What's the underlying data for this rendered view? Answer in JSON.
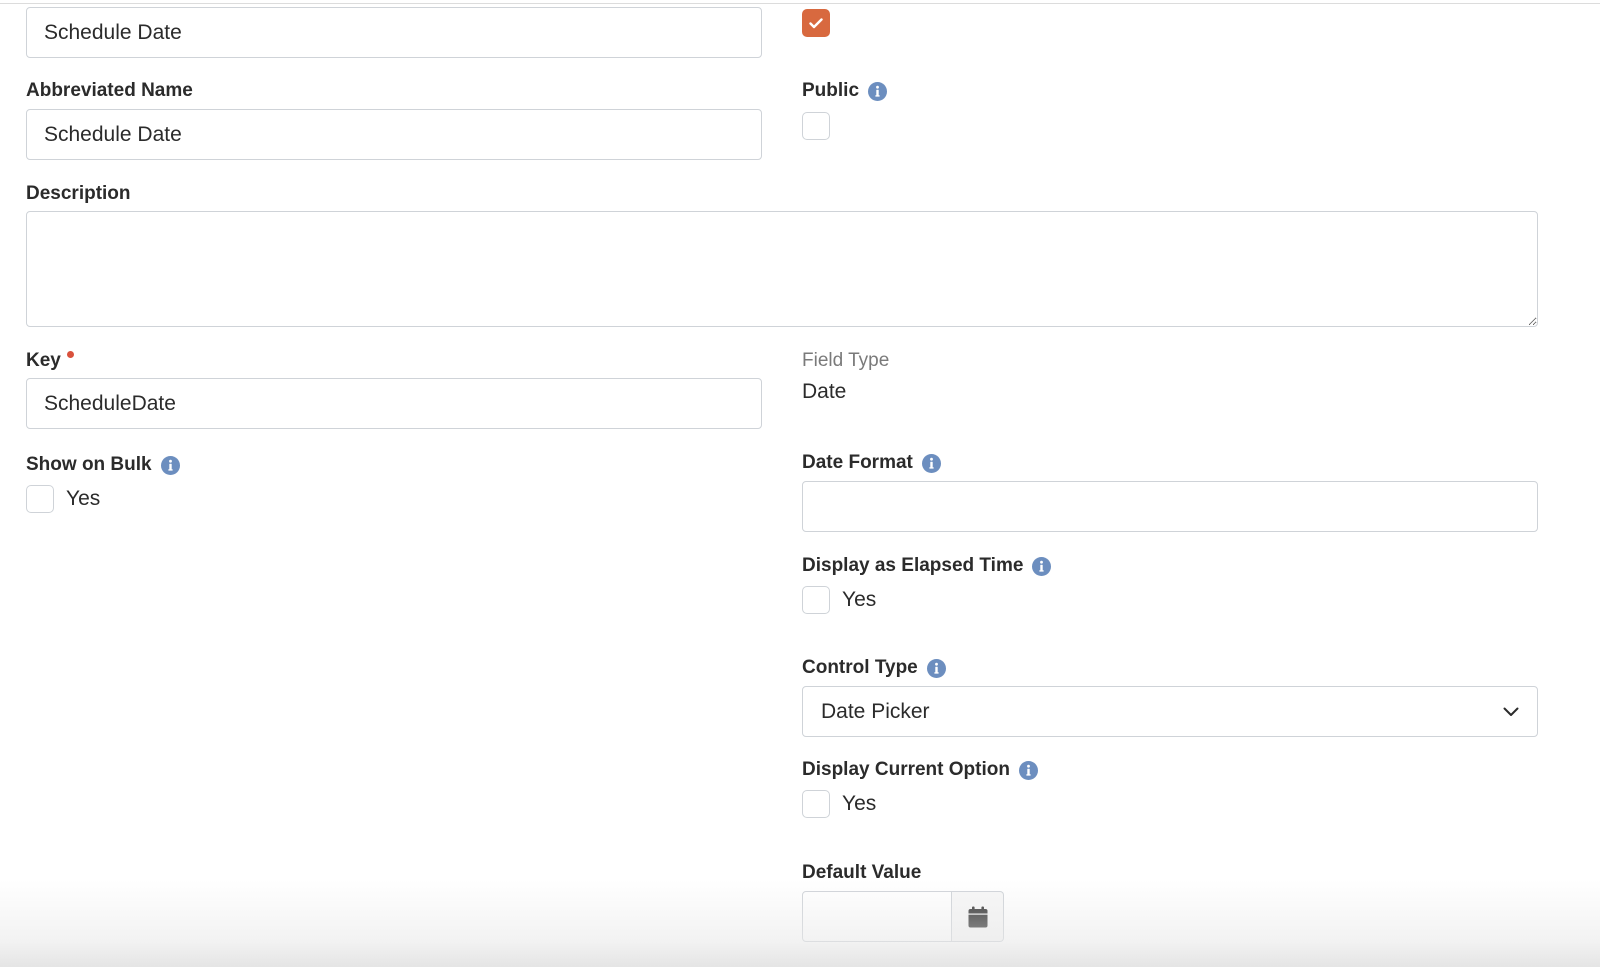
{
  "fields": {
    "name": {
      "value": "Schedule Date"
    },
    "visible": {
      "checked": true
    },
    "abbreviated_name": {
      "label": "Abbreviated Name",
      "value": "Schedule Date"
    },
    "public": {
      "label": "Public",
      "checked": false
    },
    "description": {
      "label": "Description",
      "value": ""
    },
    "key": {
      "label": "Key",
      "value": "ScheduleDate",
      "required": true
    },
    "field_type": {
      "label": "Field Type",
      "value": "Date"
    },
    "show_on_bulk": {
      "label": "Show on Bulk",
      "option_label": "Yes",
      "checked": false
    },
    "date_format": {
      "label": "Date Format",
      "value": ""
    },
    "display_elapsed_time": {
      "label": "Display as Elapsed Time",
      "option_label": "Yes",
      "checked": false
    },
    "control_type": {
      "label": "Control Type",
      "selected": "Date Picker"
    },
    "display_current_option": {
      "label": "Display Current Option",
      "option_label": "Yes",
      "checked": false
    },
    "default_value": {
      "label": "Default Value",
      "value": ""
    }
  },
  "icons": {
    "info": "info-icon",
    "check": "checkmark-icon",
    "dropdown": "chevron-down-icon",
    "calendar": "calendar-icon"
  },
  "colors": {
    "accent": "#d8693f",
    "info": "#6c8ebf",
    "required": "#d9513c",
    "border": "#cfd3d8"
  }
}
